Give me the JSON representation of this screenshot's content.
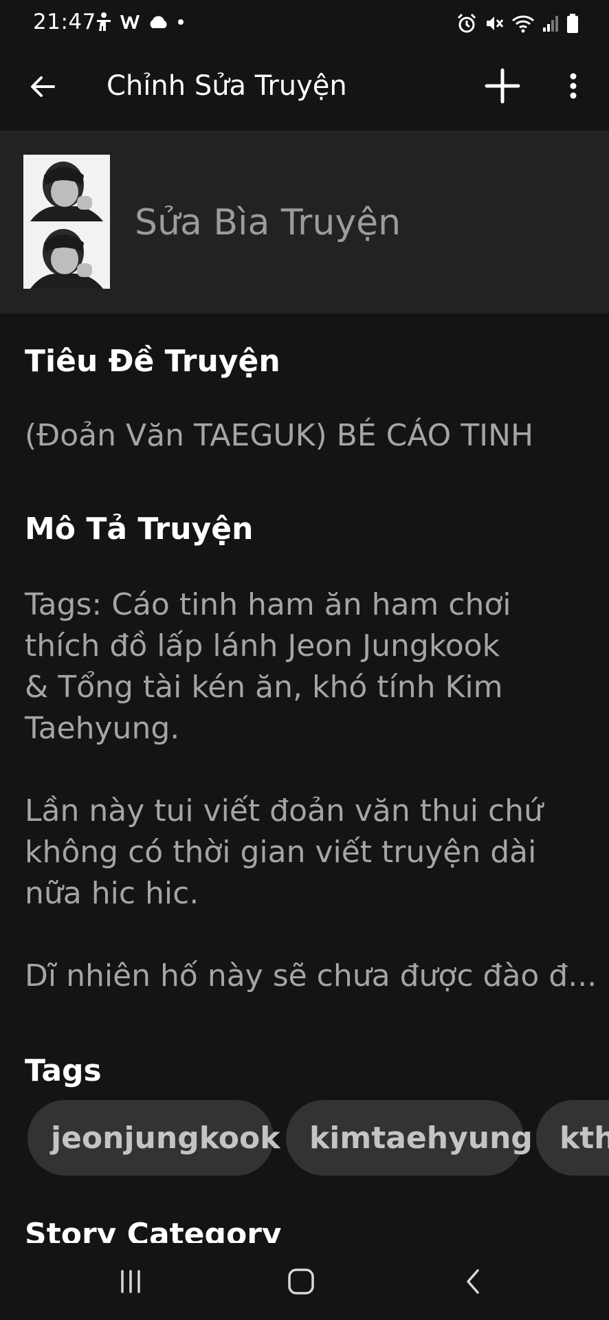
{
  "status_bar": {
    "time": "21:47",
    "left_icons": [
      "accessibility-icon",
      "w-app-icon",
      "cloud-icon",
      "dot-icon"
    ],
    "right_icons": [
      "alarm-icon",
      "mute-icon",
      "wifi-icon",
      "signal-icon",
      "battery-icon"
    ]
  },
  "app_bar": {
    "title": "Chỉnh Sửa Truyện",
    "back_icon": "arrow-left-icon",
    "add_icon": "plus-icon",
    "more_icon": "more-vertical-icon"
  },
  "cover": {
    "label": "Sửa Bìa Truyện"
  },
  "story_title": {
    "heading": "Tiêu Đề Truyện",
    "value": "(Đoản Văn TAEGUK) BÉ CÁO TINH"
  },
  "description": {
    "heading": "Mô Tả Truyện",
    "lines": [
      "Tags: Cáo tinh ham ăn ham chơi",
      "thích đồ lấp lánh Jeon Jungkook",
      "& Tổng tài kén ăn, khó tính Kim",
      "Taehyung.",
      "",
      "Lần này tui viết đoản văn thui chứ",
      "không có thời gian viết truyện dài",
      "nữa hic hic.",
      "",
      "Dĩ nhiên hố này sẽ chưa được đào đ..."
    ]
  },
  "tags": {
    "heading": "Tags",
    "items": [
      "jeonjungkook",
      "kimtaehyung",
      "kthx"
    ]
  },
  "category": {
    "heading": "Story Category"
  },
  "nav_bar": {
    "icons": [
      "recent-apps-icon",
      "home-icon",
      "back-nav-icon"
    ]
  },
  "colors": {
    "background": "#141414",
    "cover_section": "#222222",
    "tag_chip": "#333333",
    "secondary_text": "#a5a5a5"
  }
}
